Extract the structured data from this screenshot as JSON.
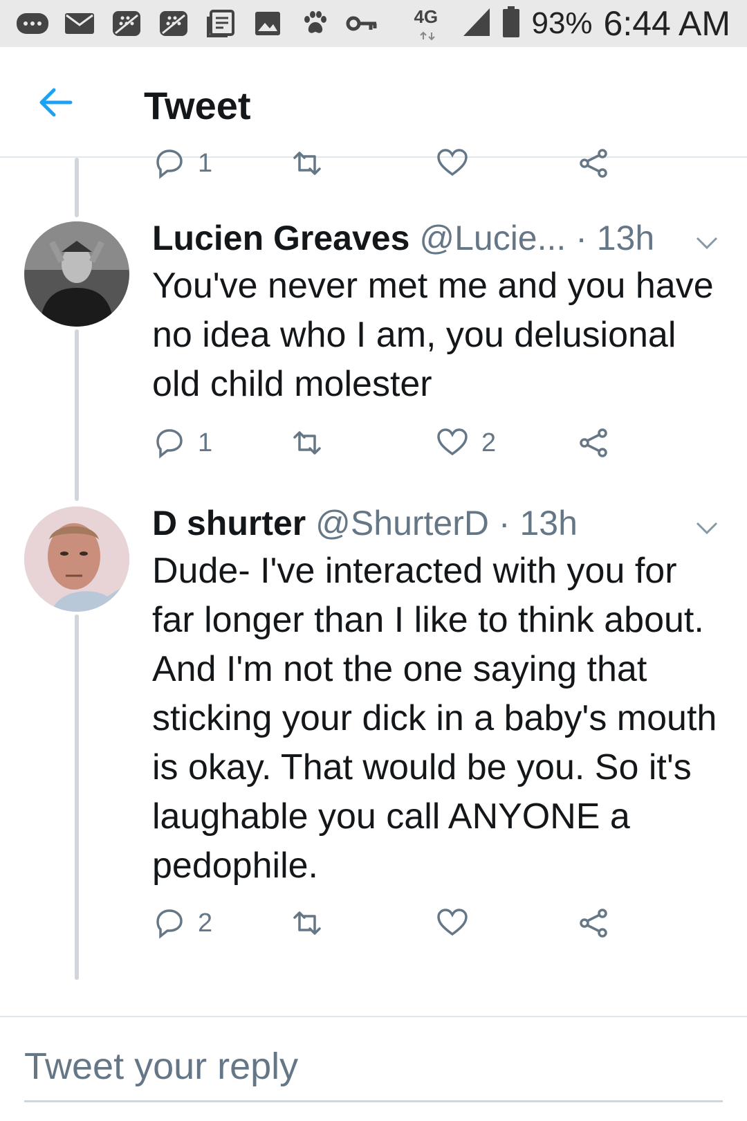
{
  "status_bar": {
    "network": "4G",
    "battery": "93%",
    "time": "6:44 AM",
    "icons": [
      "messages-icon",
      "email-icon",
      "blackberry-icon",
      "blackberry-icon",
      "news-icon",
      "gallery-icon",
      "paw-icon",
      "vpn-key-icon",
      "network-4g-icon",
      "signal-icon",
      "battery-icon"
    ]
  },
  "header": {
    "title": "Tweet",
    "back_icon": "back-arrow-icon"
  },
  "colors": {
    "accent": "#1da1f2",
    "muted": "#657786",
    "thread_line": "#d0d6dc"
  },
  "prev_tweet_actions": {
    "reply_count": "1",
    "like_count": ""
  },
  "tweets": [
    {
      "name": "Lucien Greaves",
      "handle": "@Lucie...",
      "time": "· 13h",
      "text": "You've never met me and you have no idea who I am, you delusional old child molester",
      "reply_count": "1",
      "like_count": "2"
    },
    {
      "name": "D shurter",
      "handle": "@ShurterD",
      "time": "· 13h",
      "text": "Dude- I've interacted with you for far longer than I like to think about. And I'm not the one saying that sticking your dick in a baby's mouth is okay. That would be you. So it's laughable you call ANYONE a pedophile.",
      "reply_count": "2",
      "like_count": ""
    }
  ],
  "reply": {
    "placeholder": "Tweet your reply"
  }
}
